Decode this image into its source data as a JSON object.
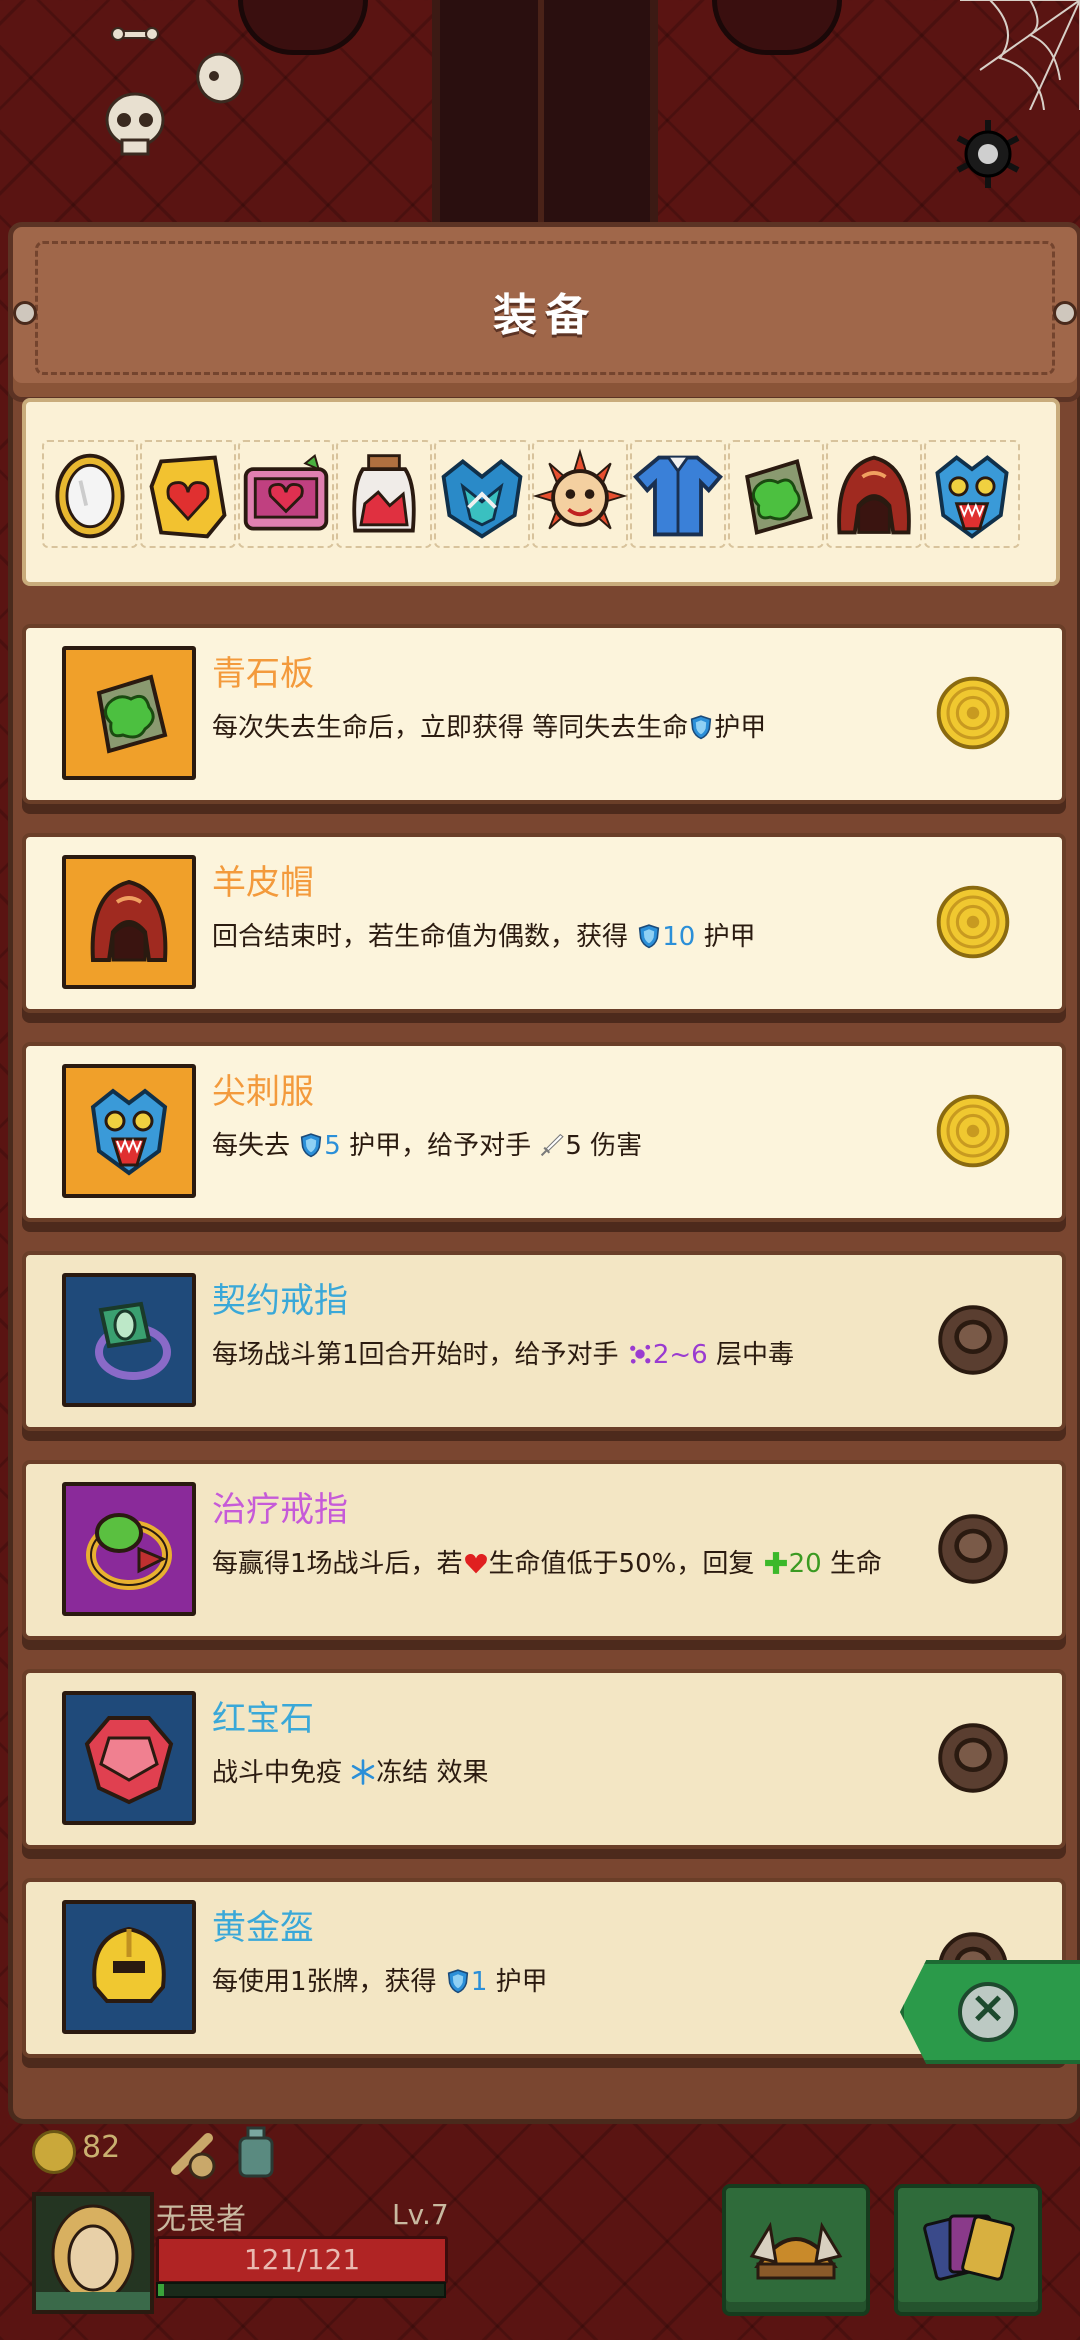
{
  "panel": {
    "title": "装备"
  },
  "strip_icons": [
    "mirror-icon",
    "heart-gem-icon",
    "heart-chest-icon",
    "potion-jar-icon",
    "dragon-mask-icon",
    "sun-mask-icon",
    "blue-robe-icon",
    "green-slate-icon",
    "sheep-hood-icon",
    "spike-armor-icon"
  ],
  "items": [
    {
      "name": "青石板",
      "state": "owned",
      "frame_color": "#f0a02a",
      "name_color": "#f39a3c",
      "icon": "green-slate-icon",
      "desc": [
        {
          "t": "每次失去生命后，立即获得 等同失去生命"
        },
        {
          "icon": "shield-icon"
        },
        {
          "t": "护甲"
        }
      ]
    },
    {
      "name": "羊皮帽",
      "state": "owned",
      "frame_color": "#f0a02a",
      "name_color": "#f39a3c",
      "icon": "sheep-hood-icon",
      "desc": [
        {
          "t": "回合结束时，若生命值为偶数，获得 "
        },
        {
          "icon": "shield-icon"
        },
        {
          "t": "10",
          "kw": "blue"
        },
        {
          "t": " 护甲"
        }
      ]
    },
    {
      "name": "尖刺服",
      "state": "owned",
      "frame_color": "#f0a02a",
      "name_color": "#f39a3c",
      "icon": "spike-armor-icon",
      "desc": [
        {
          "t": "每失去 "
        },
        {
          "icon": "shield-icon"
        },
        {
          "t": "5",
          "kw": "blue"
        },
        {
          "t": " 护甲，给予对手 "
        },
        {
          "icon": "sword-icon"
        },
        {
          "t": "5 伤害"
        }
      ]
    },
    {
      "name": "契约戒指",
      "state": "locked",
      "frame_color": "#1f4a7a",
      "name_color": "#3aa8d8",
      "icon": "contract-ring-icon",
      "desc": [
        {
          "t": "每场战斗第1回合开始时，给予对手 "
        },
        {
          "icon": "poison-icon"
        },
        {
          "t": "2~6",
          "kw": "purple"
        },
        {
          "t": " 层中毒"
        }
      ]
    },
    {
      "name": "治疗戒指",
      "state": "locked",
      "frame_color": "#8a2a9a",
      "name_color": "#c65ad8",
      "icon": "healing-ring-icon",
      "desc": [
        {
          "t": "每赢得1场战斗后，若"
        },
        {
          "icon": "heart-icon"
        },
        {
          "t": "生命值低于50%，回复 "
        },
        {
          "icon": "plus-icon"
        },
        {
          "t": "20",
          "kw": "green"
        },
        {
          "t": " 生命"
        }
      ]
    },
    {
      "name": "红宝石",
      "state": "locked",
      "frame_color": "#1f4a7a",
      "name_color": "#3aa8d8",
      "icon": "ruby-icon",
      "desc": [
        {
          "t": "战斗中免疫 "
        },
        {
          "icon": "snowflake-icon"
        },
        {
          "t": "冻结 效果"
        }
      ]
    },
    {
      "name": "黄金盔",
      "state": "locked",
      "frame_color": "#1f4a7a",
      "name_color": "#3aa8d8",
      "icon": "golden-helmet-icon",
      "desc": [
        {
          "t": "每使用1张牌，获得 "
        },
        {
          "icon": "shield-icon"
        },
        {
          "t": "1",
          "kw": "blue"
        },
        {
          "t": " 护甲"
        }
      ]
    }
  ],
  "player": {
    "gold": "82",
    "name": "无畏者",
    "level": "Lv.7",
    "hp_text": "121/121",
    "hp_fraction": 1.0,
    "xp_fraction": 0.02
  },
  "colors": {
    "accent_orange": "#f39a3c",
    "accent_blue": "#3aa8d8",
    "close_green": "#2b9a4a"
  }
}
